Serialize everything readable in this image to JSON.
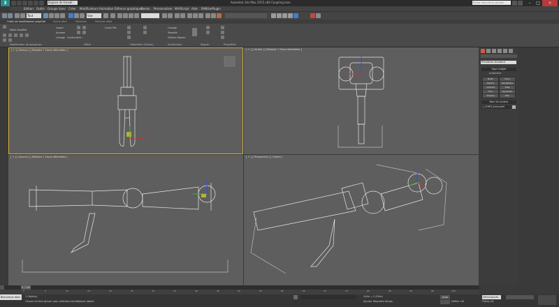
{
  "app": {
    "logo": "3",
    "window_title": "Autodesk 3ds Max 2015 x64     Coupling.max",
    "workspace": "Espace de travail : Par",
    "search_placeholder": "Entrer mot-clé ou phrase"
  },
  "menu": [
    "Edition",
    "Outils",
    "Groupe",
    "Vues",
    "Créer",
    "Modificateurs",
    "Animation",
    "Éditeurs graphiques",
    "Rendu",
    "Personnaliser",
    "MAXScript",
    "Aide",
    "RANGerPlugin"
  ],
  "toolbar": {
    "selection_filter": "Tout",
    "view_dropdown": "Vue"
  },
  "ribbon": {
    "tabs": [
      "Outils de modélisation graphite",
      "Forme libre",
      "Sélection",
      "Peinture objet"
    ],
    "mode": "Mode Modifier",
    "groups": [
      "Modification de polygones",
      "Éditer",
      "Géométrie (Toutes)",
      "Subdivision",
      "Aligner",
      "Propriétés"
    ],
    "items": {
      "loop": "Loupe",
      "ring": "Anneau",
      "smooth": "Lissage",
      "constraints": "Contraintes :",
      "make_planar": "Lisser MA",
      "tessellate": "Tessellé",
      "use_displace": "Utiliser Déplac."
    }
  },
  "viewports": {
    "top": "[ + ] [ Dessus ] [ Réaliste + Faces délimitées ]",
    "front": "[ + ] [ Arrière ] [ Réaliste + Faces délimitées ]",
    "left": "[ + ] [ Gauche ] [ Réaliste + Faces délimitées ]",
    "persp": "[ + ] [ Perspective ] [ Ombré ]"
  },
  "command_panel": {
    "dropdown": "Primitives standard",
    "object_type_header": "Type d'objet",
    "autogrid": "AutoGrille",
    "buttons": [
      "Boîte",
      "Cône",
      "Sphère",
      "GéoSphère",
      "Cylindre",
      "Tube",
      "Tore",
      "Pyramide",
      "Théière",
      "Plan"
    ],
    "name_header": "Nom et couleur",
    "object_name": "1_CHIPS_Extrude5"
  },
  "timeline": {
    "frame": "0 / 100",
    "ticks": [
      "0",
      "5",
      "10",
      "15",
      "20",
      "25",
      "30",
      "35",
      "40",
      "45",
      "50",
      "55",
      "60",
      "65",
      "70",
      "75",
      "80",
      "85",
      "90",
      "95",
      "100"
    ]
  },
  "status": {
    "script_label": "Bienvenue dans",
    "selection_info": "1 Objet(s)",
    "prompt": "Cliquer et faire glisser pour sélectionner/déplacer objets",
    "grid": "Grille = 0,254m",
    "autokey": "Auto",
    "set_key": "Définir clé",
    "key_mode": "Sélectionnés",
    "key_filters": "Filtres clé",
    "add_time_tag": "Ajouter étiquette temps"
  }
}
